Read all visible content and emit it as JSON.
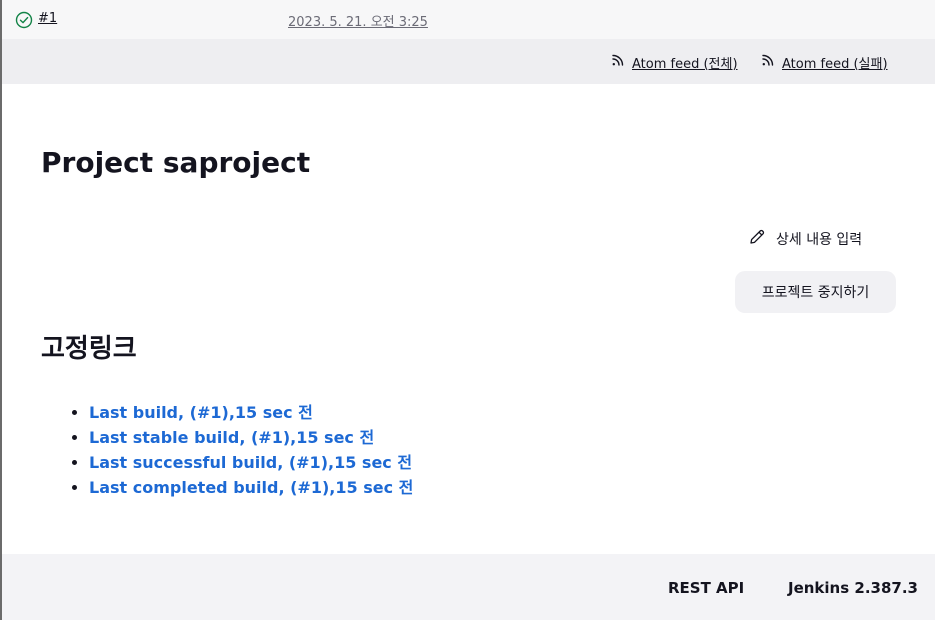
{
  "build_history": {
    "build_number": "#1",
    "build_time": "2023. 5. 21. 오전 3:25",
    "status_icon": "success-check-icon",
    "status_color": "#138347"
  },
  "feeds": {
    "all_label": "Atom feed (전체)",
    "failures_label": "Atom feed (실패)",
    "icon": "rss-icon"
  },
  "project": {
    "title": "Project saproject"
  },
  "actions": {
    "edit_description_label": "상세 내용 입력",
    "edit_icon": "pencil-icon",
    "disable_project_label": "프로젝트 중지하기"
  },
  "permalinks": {
    "heading": "고정링크",
    "items": [
      {
        "label": "Last build, (#1),15 sec 전"
      },
      {
        "label": "Last stable build, (#1),15 sec 전"
      },
      {
        "label": "Last successful build, (#1),15 sec 전"
      },
      {
        "label": "Last completed build, (#1),15 sec 전"
      }
    ],
    "link_color": "#1d69d4"
  },
  "footer": {
    "rest_api_label": "REST API",
    "version_label": "Jenkins 2.387.3"
  }
}
